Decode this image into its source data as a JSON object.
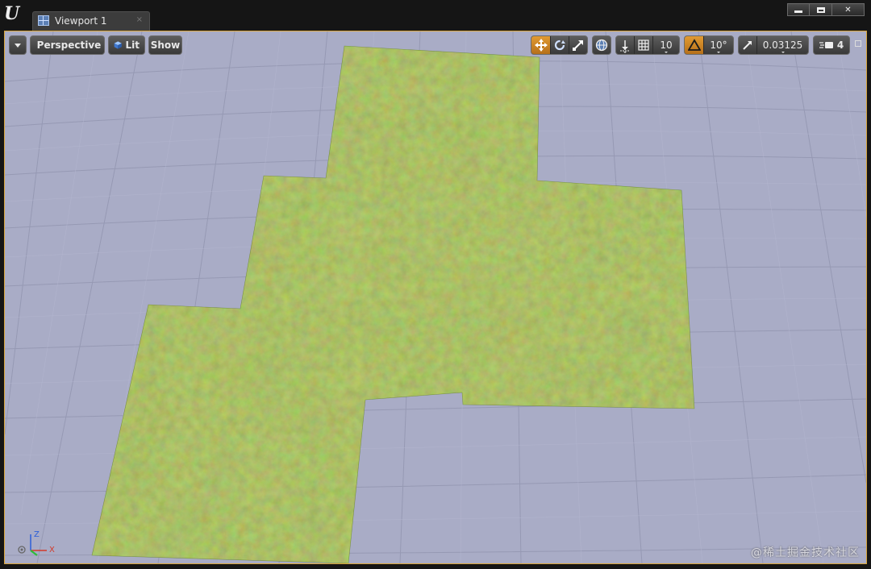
{
  "window": {
    "logo_text": "U",
    "tab_label": "Viewport 1",
    "tab_close": "×",
    "close_glyph": "✕"
  },
  "toolbar": {
    "perspective_label": "Perspective",
    "lit_label": "Lit",
    "show_label": "Show",
    "grid_snap_value": "10",
    "rotation_snap_value": "10°",
    "scale_snap_value": "0.03125",
    "camera_speed_value": "4"
  },
  "gizmo": {
    "z_label": "Z",
    "x_label": "X"
  },
  "watermark": "@稀土掘金技术社区",
  "colors": {
    "accent_orange": "#d9a53a",
    "floor": "#a9acc6",
    "grass": "#7c9c37"
  }
}
